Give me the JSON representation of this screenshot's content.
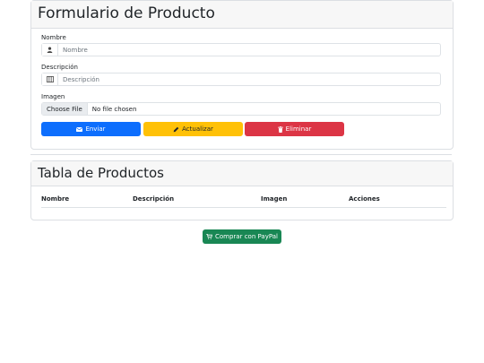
{
  "form": {
    "title": "Formulario de Producto",
    "nombre_label": "Nombre",
    "nombre_placeholder": "Nombre",
    "descripcion_label": "Descripción",
    "descripcion_placeholder": "Descripción",
    "imagen_label": "Imagen",
    "file_button": "Choose File",
    "file_status": "No file chosen"
  },
  "buttons": {
    "enviar": "Enviar",
    "actualizar": "Actualizar",
    "eliminar": "Eliminar",
    "paypal": "Comprar con PayPal"
  },
  "table": {
    "title": "Tabla de Productos",
    "headers": [
      "Nombre",
      "Descripción",
      "Imagen",
      "Acciones"
    ]
  },
  "colors": {
    "primary": "#0d6efd",
    "warning": "#ffc107",
    "danger": "#dc3545",
    "success": "#198754"
  },
  "icons": {
    "nombre": "user-icon",
    "descripcion": "columns-icon",
    "enviar": "envelope-icon",
    "actualizar": "pencil-icon",
    "eliminar": "trash-icon",
    "paypal": "cart-icon"
  }
}
